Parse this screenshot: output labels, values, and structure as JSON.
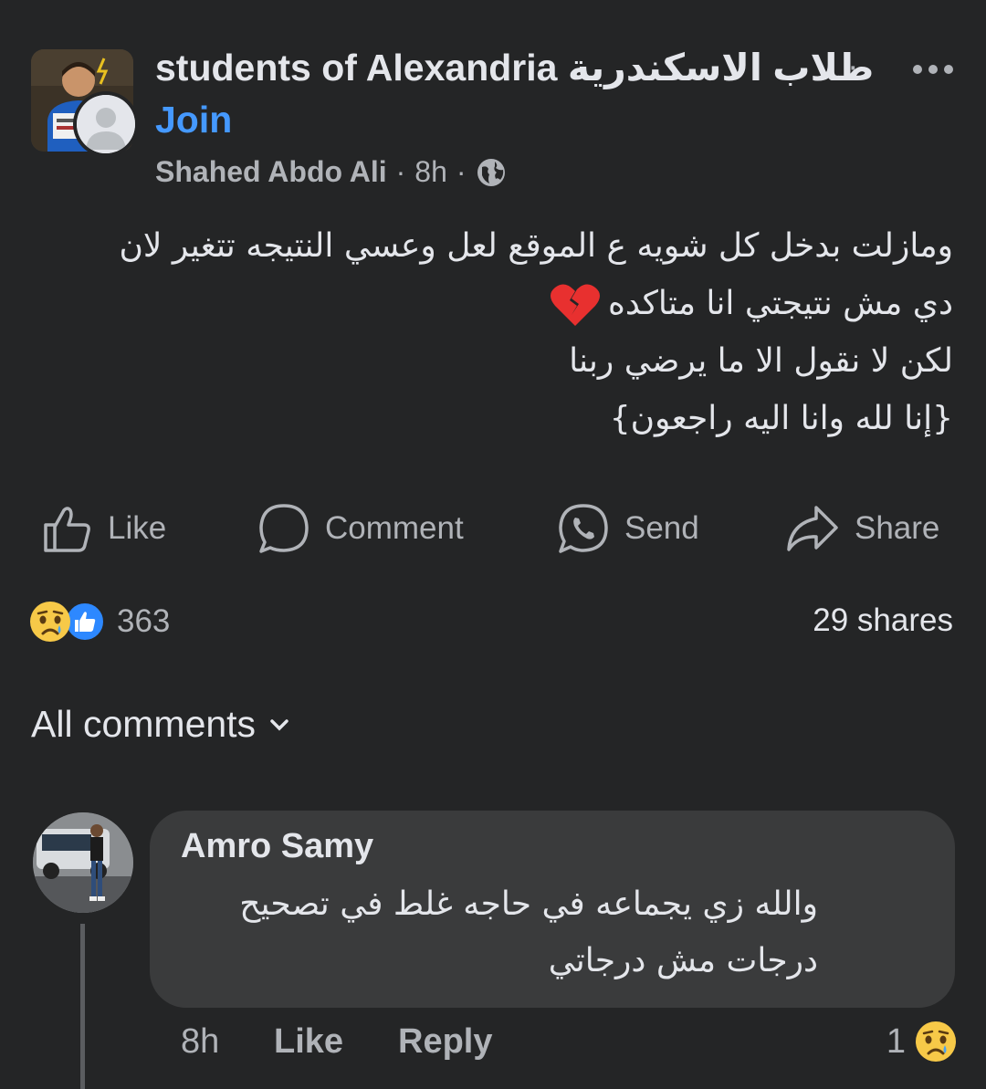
{
  "header": {
    "group_name": "students of Alexandria طلاب الاسكندرية",
    "dot": "·",
    "join_label": "Join",
    "author": "Shahed Abdo Ali",
    "time": "8h",
    "separator": "·",
    "privacy_icon": "globe-icon",
    "more_icon": "more-dots-icon"
  },
  "post": {
    "lines": [
      "ومازلت بدخل كل شويه ع الموقع لعل وعسي النتيجه تتغير لان",
      "دي مش نتيجتي انا متاكده",
      "لكن لا نقول الا ما يرضي ربنا",
      "{إنا لله وانا اليه راجعون}"
    ],
    "emoji_icon": "broken-heart-icon"
  },
  "actions": {
    "like": "Like",
    "comment": "Comment",
    "send": "Send",
    "share": "Share"
  },
  "stats": {
    "reaction_count": "363",
    "shares": "29 shares",
    "reaction_icons": [
      "sad-reaction-icon",
      "like-reaction-icon"
    ]
  },
  "comments_section": {
    "filter_label": "All comments"
  },
  "comment": {
    "author": "Amro Samy",
    "lines": [
      "والله زي يجماعه في حاجه غلط في تصحيح",
      "درجات مش درجاتي"
    ],
    "time": "8h",
    "like_label": "Like",
    "reply_label": "Reply",
    "reaction_count": "1"
  },
  "colors": {
    "background": "#242526",
    "bubble": "#3a3b3c",
    "link": "#4599ff",
    "secondary_text": "#b0b3b8",
    "primary_text": "#e4e6eb"
  }
}
